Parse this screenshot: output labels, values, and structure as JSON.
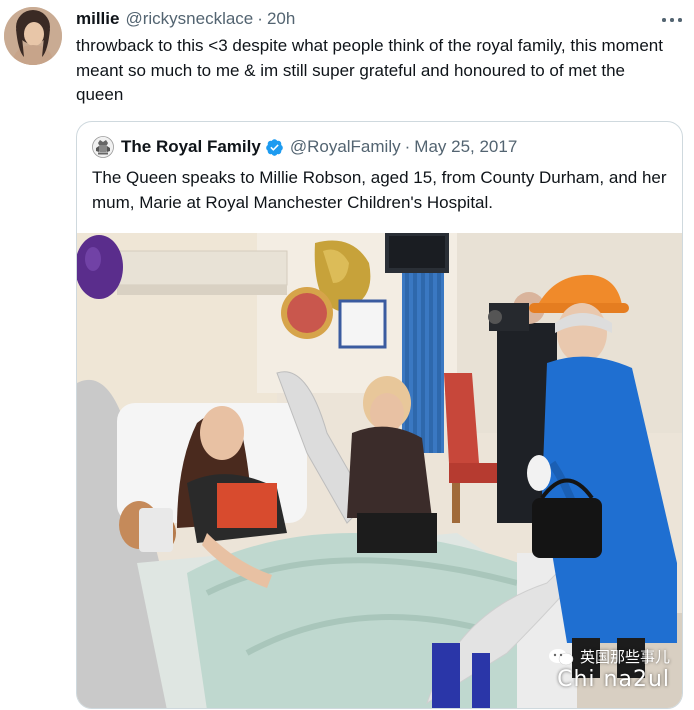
{
  "tweet": {
    "display_name": "millie",
    "handle": "@rickysnecklace",
    "separator": "·",
    "time": "20h",
    "text": "throwback to this <3 despite what people think of the royal family, this moment meant so much to me & im still super grateful and honoured to of met the queen"
  },
  "quoted": {
    "display_name": "The Royal Family",
    "handle": "@RoyalFamily",
    "separator": "·",
    "date": "May 25, 2017",
    "text": "The Queen speaks to Millie Robson, aged 15, from County Durham, and her mum, Marie at Royal Manchester Children's Hospital."
  },
  "watermark": {
    "line1": "英国那些事儿",
    "line2": "Chi na2ul"
  },
  "icons": {
    "more": "more-horizontal-icon",
    "verified": "verified-badge-icon",
    "crest": "royal-crest-icon",
    "wechat": "wechat-icon"
  },
  "colors": {
    "text": "#0f1419",
    "secondary": "#536471",
    "verified": "#1d9bf0",
    "border": "#cfd9de",
    "queen_coat": "#1f6fd1",
    "queen_hat": "#f08a2a"
  }
}
